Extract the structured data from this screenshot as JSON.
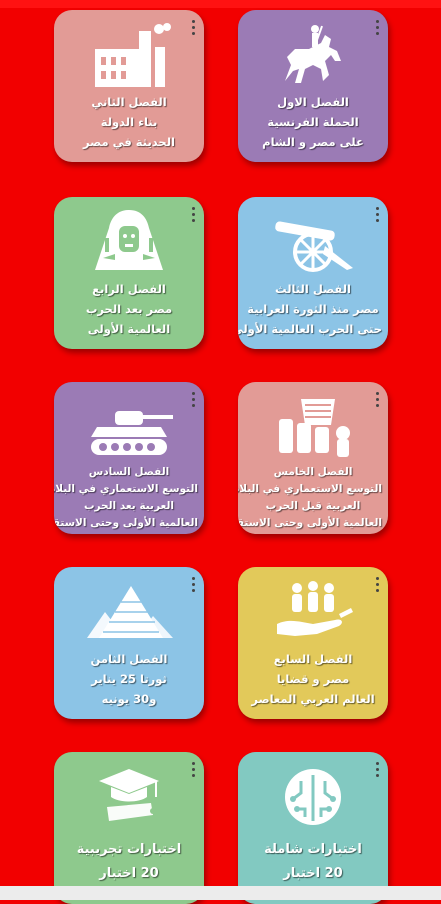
{
  "cards": [
    {
      "id": "ch1",
      "lines": [
        "الفصل الاول",
        "الحملة الفرنسية",
        "على مصر و الشام"
      ],
      "icon": "horseman-icon",
      "color": "#9b7bb5"
    },
    {
      "id": "ch2",
      "lines": [
        "الفصل الثاني",
        "بناء الدولة",
        "الحديثة في مصر"
      ],
      "icon": "factory-icon",
      "color": "#e29b96"
    },
    {
      "id": "ch3",
      "lines": [
        "الفصل الثالث",
        "مصر منذ الثورة العرابية",
        "حتى الحرب العالمية الأولى"
      ],
      "icon": "cannon-icon",
      "color": "#8cc4e6"
    },
    {
      "id": "ch4",
      "lines": [
        "الفصل الرابع",
        "مصر بعد الحرب",
        "العالمية الأولى"
      ],
      "icon": "pharaoh-icon",
      "color": "#8ec98d"
    },
    {
      "id": "ch5",
      "lines": [
        "الفصل الخامس",
        "التوسع الاستعماري في البلاد",
        "العربية قبل الحرب",
        "العالمية الأولى وحتى الاستقلال"
      ],
      "icon": "colonial-icon",
      "color": "#e29b96"
    },
    {
      "id": "ch6",
      "lines": [
        "الفصل السادس",
        "التوسع الاستعماري في البلاد",
        "العربية بعد الحرب",
        "العالمية الأولى وحتى الاستقلال"
      ],
      "icon": "tank-icon",
      "color": "#9b7bb5"
    },
    {
      "id": "ch7",
      "lines": [
        "الفصل السابع",
        "مصر و قضايا",
        "العالم العربي المعاصر"
      ],
      "icon": "people-hand-icon",
      "color": "#e2c95a"
    },
    {
      "id": "ch8",
      "lines": [
        "الفصل الثامن",
        "ثورتا 25 يناير",
        "و30 يونيه"
      ],
      "icon": "pyramids-icon",
      "color": "#8cc4e6"
    },
    {
      "id": "exam-full",
      "lines": [
        "اختبارات شاملة",
        "20 اختبار"
      ],
      "icon": "brain-circuit-icon",
      "color": "#82c9c1"
    },
    {
      "id": "exam-trial",
      "lines": [
        "اختبارات تجريبية",
        "20 اختبار"
      ],
      "icon": "graduation-cap-icon",
      "color": "#8ec98d"
    }
  ]
}
